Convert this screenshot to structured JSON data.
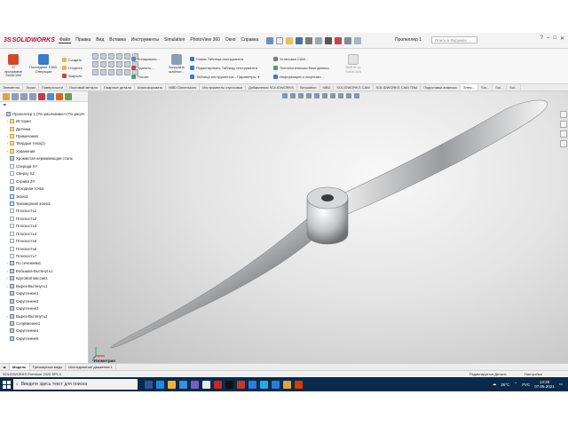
{
  "app": {
    "logo_text": "SOLIDWORKS",
    "document_title": "Пропеллер 1",
    "search_placeholder": "Поиск в Форумах"
  },
  "menu": [
    "Файл",
    "Правка",
    "Вид",
    "Вставка",
    "Инструменты",
    "Simulation",
    "PhotoView 360",
    "Окно",
    "Справка"
  ],
  "ribbon": {
    "btn_open_program": "О программе SolidCAM",
    "btn_operations": "Последние CAM-Операции",
    "btn_create": "Создать",
    "btn_open": "Открыть",
    "btn_close": "Закрыть",
    "btn_copy": "Копировать...",
    "btn_delete": "Удалить...",
    "btn_calc": "Расчет",
    "btn_load_template": "Загрузить шаблон...",
    "btn_new_tool_table": "Новая Таблица инструмента",
    "btn_tool_editor": "Редактировать Таблицу инструмента",
    "btn_tool_params": "Таблица инструментов - Параметры",
    "btn_cam_settings": "Установки CAM...",
    "btn_tech_base": "Технологическая база данных",
    "btn_cam_info": "Информация о лицензии...",
    "btn_exit": "Выйти из SolidCAM"
  },
  "command_tabs": [
    "Элементы",
    "Эскиз",
    "Поверхности",
    "Листовой металл",
    "Сварные детали",
    "Анализировать",
    "MBD Dimensions",
    "Инструменты отрисовки",
    "Добавления SOLIDWORKS",
    "Simulation",
    "MBD",
    "SOLIDWORKS CAM",
    "SOLIDWORKS CAM TBM",
    "Подготовка анализа",
    "Элем...",
    "Sol...",
    "Sol...",
    "Sol..."
  ],
  "tree": {
    "root": "Пропеллер 1 (По умолчанию<<По умолч",
    "items": [
      {
        "label": "История",
        "type": "folder",
        "expand": "›"
      },
      {
        "label": "Датчики",
        "type": "folder",
        "expand": ""
      },
      {
        "label": "Примечания",
        "type": "folder",
        "expand": "›"
      },
      {
        "label": "Твердые тела(1)",
        "type": "folder",
        "expand": "›"
      },
      {
        "label": "Уравнения",
        "type": "folder",
        "expand": "›"
      },
      {
        "label": "Хромистая нержавеющая сталь",
        "type": "feat",
        "expand": ""
      },
      {
        "label": "Спереди XY",
        "type": "plane",
        "expand": ""
      },
      {
        "label": "Сверху XZ",
        "type": "plane",
        "expand": ""
      },
      {
        "label": "Справа ZY",
        "type": "plane",
        "expand": ""
      },
      {
        "label": "Исходная точка",
        "type": "feat",
        "expand": ""
      },
      {
        "label": "Эскиз1",
        "type": "sketch",
        "expand": ""
      },
      {
        "label": "Трехмерный эскиз1",
        "type": "sketch",
        "expand": ""
      },
      {
        "label": "Плоскость1",
        "type": "plane",
        "expand": ""
      },
      {
        "label": "Плоскость2",
        "type": "plane",
        "expand": ""
      },
      {
        "label": "Плоскость3",
        "type": "plane",
        "expand": ""
      },
      {
        "label": "Плоскость4",
        "type": "plane",
        "expand": ""
      },
      {
        "label": "Плоскость5",
        "type": "plane",
        "expand": ""
      },
      {
        "label": "Плоскость6",
        "type": "plane",
        "expand": ""
      },
      {
        "label": "Плоскость7",
        "type": "plane",
        "expand": ""
      },
      {
        "label": "По сечениям1",
        "type": "feat",
        "expand": "›"
      },
      {
        "label": "Бобышка-Вытянуть1",
        "type": "feat",
        "expand": "›"
      },
      {
        "label": "Круговой массив1",
        "type": "feat",
        "expand": "›"
      },
      {
        "label": "Вырез-Вытянуть1",
        "type": "feat",
        "expand": "›"
      },
      {
        "label": "Скругление1",
        "type": "feat",
        "expand": ""
      },
      {
        "label": "Скругление2",
        "type": "feat",
        "expand": ""
      },
      {
        "label": "Скругление3",
        "type": "feat",
        "expand": ""
      },
      {
        "label": "Вырез-Вытянуть2",
        "type": "feat",
        "expand": "›"
      },
      {
        "label": "Сопряжение1",
        "type": "feat",
        "expand": ""
      },
      {
        "label": "Скругление4",
        "type": "feat",
        "expand": ""
      },
      {
        "label": "Скругление5",
        "type": "feat",
        "expand": ""
      }
    ]
  },
  "viewport": {
    "note_label": "*Изометрия"
  },
  "bottom_tabs": [
    "Модель",
    "Трехмерные виды",
    "Исследование движения 1"
  ],
  "status": {
    "left": "SOLIDWORKS Premium 2020 SP1.0",
    "mid": "Редактируется Деталь",
    "right": "Настройка"
  },
  "taskbar": {
    "search_placeholder": "Введите здесь текст для поиска",
    "temperature": "26°C",
    "lang": "РУС",
    "time": "13:29",
    "date": "07.05.2021"
  },
  "colors": {
    "brand_red": "#c8102e",
    "taskbar_bg": "#0b2a4a",
    "tree_link": "#1a5fa8"
  }
}
